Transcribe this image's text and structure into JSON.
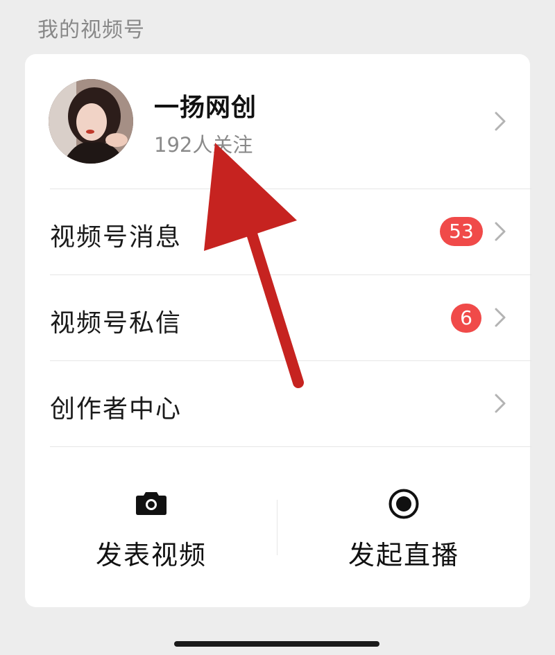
{
  "section": {
    "title": "我的视频号"
  },
  "profile": {
    "name": "一扬网创",
    "followers": "192人关注"
  },
  "menu": [
    {
      "label": "视频号消息",
      "badge": "53"
    },
    {
      "label": "视频号私信",
      "badge": "6"
    },
    {
      "label": "创作者中心"
    }
  ],
  "actions": {
    "post_video": "发表视频",
    "start_live": "发起直播"
  },
  "colors": {
    "background": "#ededed",
    "card": "#ffffff",
    "badge": "#f04a49",
    "annotation_arrow": "#c62320"
  },
  "icons": [
    "chevron-right-icon",
    "camera-icon",
    "live-record-icon",
    "annotation-arrow"
  ]
}
